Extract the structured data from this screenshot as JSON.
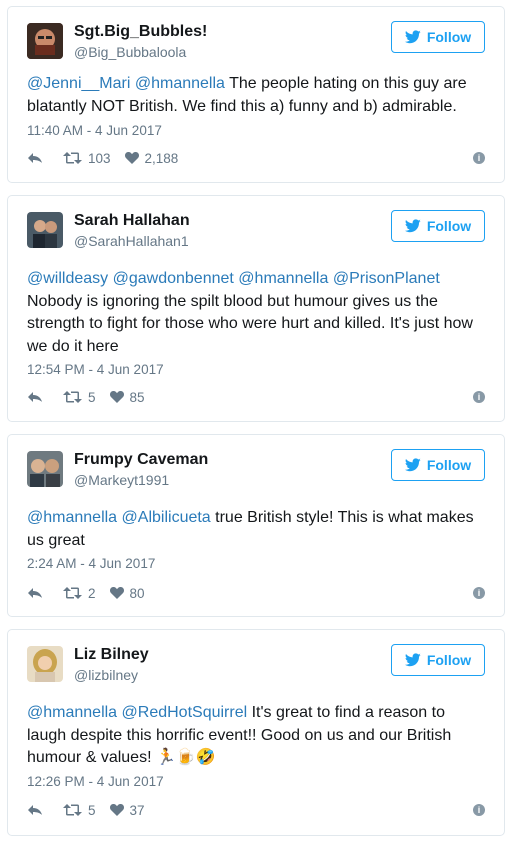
{
  "colors": {
    "link": "#2b7bb9",
    "follow": "#1da1f2",
    "muted": "#657786"
  },
  "tweets": [
    {
      "name": "Sgt.Big_Bubbles!",
      "handle": "@Big_Bubbaloola",
      "follow_label": "Follow",
      "text_parts": [
        {
          "t": "@Jenni__Mari",
          "m": true
        },
        {
          "t": " ",
          "m": false
        },
        {
          "t": "@hmannella",
          "m": true
        },
        {
          "t": " The people hating on this guy are blatantly NOT British. We find this a) funny and b) admirable.",
          "m": false
        }
      ],
      "timestamp": "11:40 AM - 4 Jun 2017",
      "retweets": "103",
      "likes": "2,188"
    },
    {
      "name": "Sarah Hallahan",
      "handle": "@SarahHallahan1",
      "follow_label": "Follow",
      "text_parts": [
        {
          "t": "@willdeasy",
          "m": true
        },
        {
          "t": " ",
          "m": false
        },
        {
          "t": "@gawdonbennet",
          "m": true
        },
        {
          "t": " ",
          "m": false
        },
        {
          "t": "@hmannella",
          "m": true
        },
        {
          "t": " ",
          "m": false
        },
        {
          "t": "@PrisonPlanet",
          "m": true
        },
        {
          "t": " Nobody is ignoring the spilt blood but humour gives us the strength to fight for those who were hurt and killed. It's just how we do it here",
          "m": false
        }
      ],
      "timestamp": "12:54 PM - 4 Jun 2017",
      "retweets": "5",
      "likes": "85"
    },
    {
      "name": "Frumpy Caveman",
      "handle": "@Markeyt1991",
      "follow_label": "Follow",
      "text_parts": [
        {
          "t": "@hmannella",
          "m": true
        },
        {
          "t": " ",
          "m": false
        },
        {
          "t": "@Albilicueta",
          "m": true
        },
        {
          "t": " true British style! This is what makes us great",
          "m": false
        }
      ],
      "timestamp": "2:24 AM - 4 Jun 2017",
      "retweets": "2",
      "likes": "80"
    },
    {
      "name": "Liz Bilney",
      "handle": "@lizbilney",
      "follow_label": "Follow",
      "text_parts": [
        {
          "t": "@hmannella",
          "m": true
        },
        {
          "t": " ",
          "m": false
        },
        {
          "t": "@RedHotSquirrel",
          "m": true
        },
        {
          "t": " It's great to find a reason to laugh despite this horrific event!! Good on us and our British humour & values! 🏃🍺🤣",
          "m": false
        }
      ],
      "timestamp": "12:26 PM - 4 Jun 2017",
      "retweets": "5",
      "likes": "37"
    }
  ]
}
